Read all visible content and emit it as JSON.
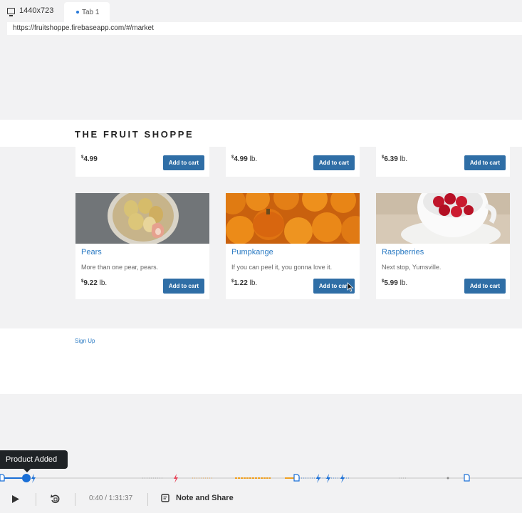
{
  "browser": {
    "viewport": "1440x723",
    "tab_label": "Tab 1",
    "url": "https://fruitshoppe.firebaseapp.com/#/market"
  },
  "site": {
    "brand": "THE FRUIT SHOPPE",
    "footer_link": "Sign Up"
  },
  "top_row": [
    {
      "price_currency": "$",
      "price_value": "4.99",
      "price_unit": "",
      "button": "Add to cart"
    },
    {
      "price_currency": "$",
      "price_value": "4.99",
      "price_unit": "lb.",
      "button": "Add to cart"
    },
    {
      "price_currency": "$",
      "price_value": "6.39",
      "price_unit": "lb.",
      "button": "Add to cart"
    }
  ],
  "products": [
    {
      "name": "Pears",
      "description": "More than one pear, pears.",
      "price_currency": "$",
      "price_value": "9.22",
      "price_unit": "lb.",
      "button": "Add to cart"
    },
    {
      "name": "Pumpkange",
      "description": "If you can peel it, you gonna love it.",
      "price_currency": "$",
      "price_value": "1.22",
      "price_unit": "lb.",
      "button": "Add to cart"
    },
    {
      "name": "Raspberries",
      "description": "Next stop, Yumsville.",
      "price_currency": "$",
      "price_value": "5.99",
      "price_unit": "lb.",
      "button": "Add to cart"
    }
  ],
  "player": {
    "tooltip": "Product Added",
    "time": "0:40 / 1:31:37",
    "note_label": "Note and Share",
    "progress": 0.05
  },
  "colors": {
    "accent": "#2a7ac3",
    "button": "#2f6ea6",
    "timeline_blue": "#1a6fd6",
    "timeline_orange": "#f0a020",
    "timeline_red": "#e8455a"
  }
}
